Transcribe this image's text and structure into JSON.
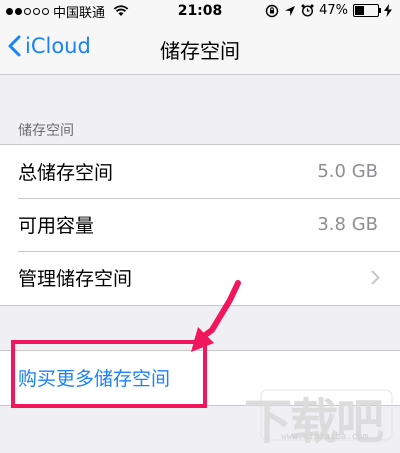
{
  "status_bar": {
    "carrier": "中国联通",
    "time": "21:08",
    "battery_percent": "47%",
    "battery_level": 0.47,
    "signal_bars": 2,
    "signal_total": 5
  },
  "nav": {
    "back_label": "iCloud",
    "title": "储存空间"
  },
  "section": {
    "header": "储存空间"
  },
  "rows": [
    {
      "label": "总储存空间",
      "value": "5.0 GB"
    },
    {
      "label": "可用容量",
      "value": "3.8 GB"
    },
    {
      "label": "管理储存空间",
      "value": ""
    }
  ],
  "buy": {
    "label": "购买更多储存空间"
  },
  "watermark": {
    "text": "下载吧",
    "url": "www.xiazaiba.com"
  },
  "colors": {
    "accent": "#1a82fb",
    "highlight": "#f2175c",
    "background": "#efeff4"
  }
}
